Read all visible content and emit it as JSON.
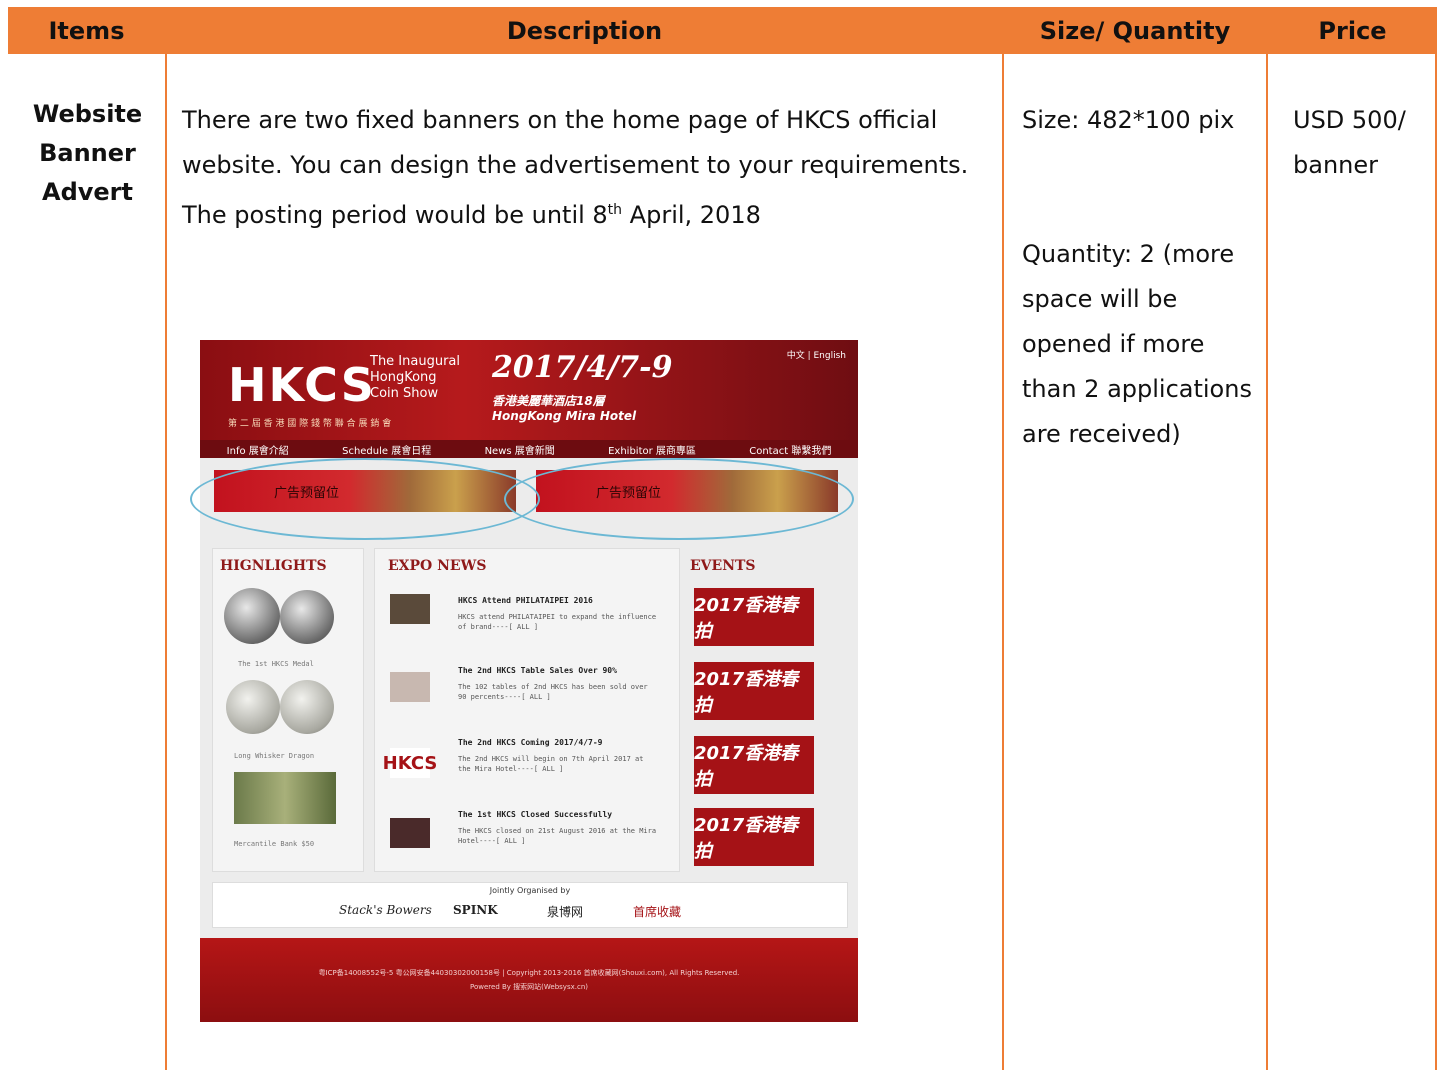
{
  "table": {
    "headers": [
      "Items",
      "Description",
      "Size/ Quantity",
      "Price"
    ],
    "row": {
      "item_line1": "Website",
      "item_line2": "Banner",
      "item_line3": "Advert",
      "desc_before_sup": "There are two fixed banners on the home page of HKCS official website. You can design the advertisement to your requirements. The posting period would be until 8",
      "desc_sup": "th",
      "desc_after_sup": " April, 2018",
      "size": "Size: 482*100 pix",
      "quantity": "Quantity:  2 (more space will be opened if more than 2 applications are received)",
      "price_line1": "USD 500/",
      "price_line2": "banner"
    }
  },
  "site_image": {
    "logo": "HKCS",
    "logo_sub": [
      "The Inaugural",
      "HongKong",
      "Coin Show"
    ],
    "date": "2017/4/7-9",
    "venue_cn": "香港美麗華酒店18層",
    "venue": "HongKong Mira Hotel",
    "subline": "第 二 屆 香 港 國 際 錢 幣 聯 合 展 銷 會",
    "lang": "中文 | English",
    "nav": [
      "Info 展會介紹",
      "Schedule 展會日程",
      "News 展會新聞",
      "Exhibitor 展商專區",
      "Contact 聯繫我們"
    ],
    "ad_label": "广告预留位",
    "col_titles": [
      "HIGNLIGHTS",
      "EXPO NEWS",
      "EVENTS"
    ],
    "highlight_captions": [
      "The 1st HKCS Medal",
      "Long Whisker Dragon",
      "Mercantile Bank $50"
    ],
    "news": [
      {
        "title": "HKCS Attend PHILATAIPEI 2016",
        "text": "HKCS attend PHILATAIPEI to expand the influence of brand----[ ALL ]"
      },
      {
        "title": "The 2nd HKCS Table Sales Over 90%",
        "text": "The 102 tables of 2nd HKCS has been sold over 90 percents----[ ALL ]"
      },
      {
        "title": "The 2nd HKCS Coming 2017/4/7-9",
        "text": "The 2nd HKCS will begin on 7th April 2017 at the Mira Hotel----[ ALL ]"
      },
      {
        "title": "The 1st HKCS Closed Successfully",
        "text": "The HKCS closed on 21st August 2016 at the Mira Hotel----[ ALL ]"
      }
    ],
    "event_label": "2017香港春拍",
    "org_title": "Jointly Organised by",
    "org_logos": [
      "Stack's Bowers",
      "SPINK",
      "泉博网",
      "首席收藏"
    ],
    "footer_line1": "粤ICP备14008552号-5  粤公网安备44030302000158号 | Copyright 2013-2016 首席收藏网(Shouxi.com), All Rights Reserved.",
    "footer_line2": "Powered By 搜索网站(Websysx.cn)"
  }
}
